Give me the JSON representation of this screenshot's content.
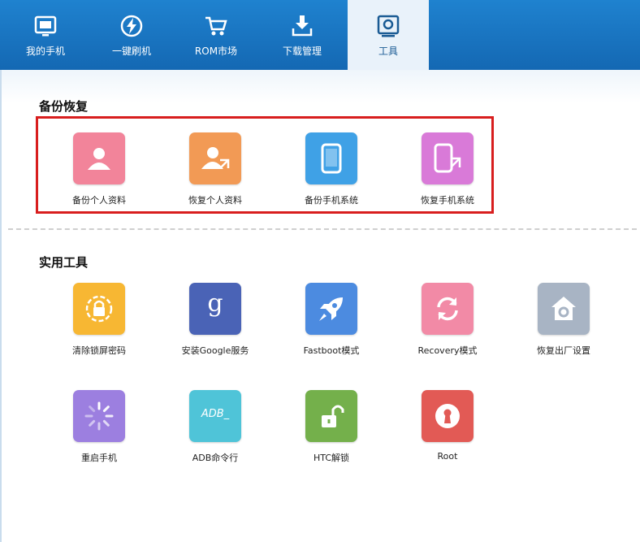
{
  "nav": {
    "tabs": [
      {
        "label": "我的手机",
        "icon": "phone-monitor-icon"
      },
      {
        "label": "一键刷机",
        "icon": "flash-icon"
      },
      {
        "label": "ROM市场",
        "icon": "shopping-cart-icon"
      },
      {
        "label": "下载管理",
        "icon": "download-icon"
      },
      {
        "label": "工具",
        "icon": "toolbox-icon"
      }
    ],
    "active_tab": "工具",
    "bar_color": "#1a73c0",
    "active_color": "#e9f2fa"
  },
  "backup_section": {
    "title": "备份恢复",
    "items": [
      {
        "label": "备份个人资料",
        "icon": "person-icon",
        "color": "#f2849a"
      },
      {
        "label": "恢复个人资料",
        "icon": "person-restore-icon",
        "color": "#f29a55"
      },
      {
        "label": "备份手机系统",
        "icon": "phone-icon",
        "color": "#3fa1e6"
      },
      {
        "label": "恢复手机系统",
        "icon": "phone-restore-icon",
        "color": "#d97ad8"
      }
    ],
    "highlight_color": "#d81e1e"
  },
  "tools_section": {
    "title": "实用工具",
    "items": [
      {
        "label": "清除锁屏密码",
        "icon": "lock-clock-icon",
        "color": "#f7b733"
      },
      {
        "label": "安装Google服务",
        "icon": "google-g-icon",
        "color": "#4a63b6",
        "glyph": "g"
      },
      {
        "label": "Fastboot模式",
        "icon": "rocket-icon",
        "color": "#4c8be0"
      },
      {
        "label": "Recovery模式",
        "icon": "refresh-icon",
        "color": "#f28aa6"
      },
      {
        "label": "恢复出厂设置",
        "icon": "home-gear-icon",
        "color": "#a8b4c4"
      },
      {
        "label": "重启手机",
        "icon": "loading-spinner-icon",
        "color": "#9c7fe0"
      },
      {
        "label": "ADB命令行",
        "icon": "terminal-adb-icon",
        "color": "#4fc4d8",
        "glyph": "ADB_"
      },
      {
        "label": "HTC解锁",
        "icon": "unlock-icon",
        "color": "#74b04b"
      },
      {
        "label": "Root",
        "icon": "keyhole-icon",
        "color": "#e25a55"
      }
    ]
  }
}
